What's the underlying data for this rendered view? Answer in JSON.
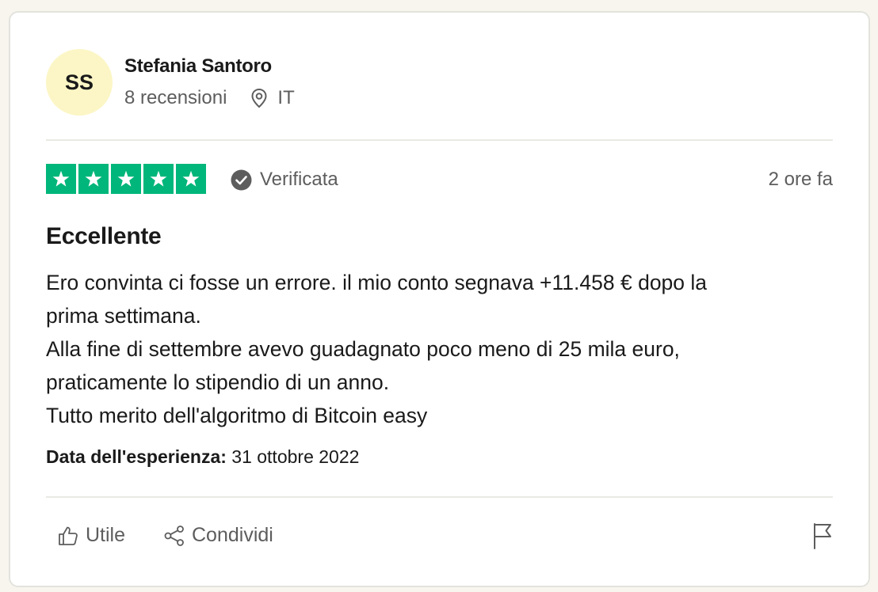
{
  "reviewer": {
    "initials": "SS",
    "name": "Stefania Santoro",
    "review_count": "8 recensioni",
    "country": "IT"
  },
  "rating": {
    "stars": 5,
    "max_stars": 5,
    "star_color": "#00b67a",
    "verified_label": "Verificata",
    "posted": "2 ore fa"
  },
  "review": {
    "title": "Eccellente",
    "lines": [
      "Ero convinta ci fosse un errore. il mio conto segnava +11.458 € dopo la",
      "prima settimana.",
      "Alla fine di settembre avevo guadagnato poco meno di 25 mila euro,",
      "praticamente lo stipendio di un anno.",
      "Tutto merito dell'algoritmo di Bitcoin easy"
    ],
    "experience_label": "Data dell'esperienza:",
    "experience_date": " 31 ottobre 2022"
  },
  "actions": {
    "useful_label": "Utile",
    "share_label": "Condividi"
  },
  "colors": {
    "avatar_bg": "#fcf6c6",
    "muted_text": "#5d5d5d"
  },
  "icons": {
    "location": "location-pin-icon",
    "verified": "check-circle-icon",
    "useful": "thumbs-up-icon",
    "share": "share-icon",
    "report": "flag-icon"
  }
}
